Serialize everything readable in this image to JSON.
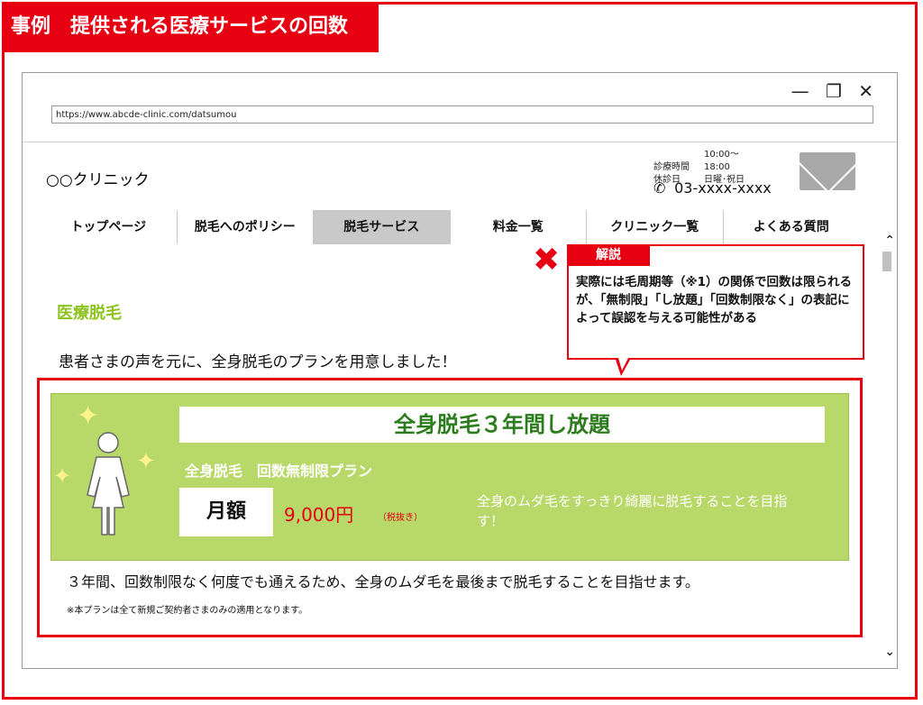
{
  "header": {
    "title": "事例　提供される医療サービスの回数"
  },
  "browser": {
    "url": "https://www.abcde-clinic.com/datsumou",
    "controls": [
      "—",
      "❐",
      "✕"
    ]
  },
  "clinic": {
    "name": "○○クリニック",
    "hours_label": "診療時間",
    "hours_value": "10:00～18:00",
    "closed_label": "休診日",
    "closed_value": "日曜･祝日",
    "phone": "03-xxxx-xxxx"
  },
  "nav": {
    "items": [
      "トップページ",
      "脱毛へのポリシー",
      "脱毛サービス",
      "料金一覧",
      "クリニック一覧",
      "よくある質問"
    ]
  },
  "callout": {
    "label": "解説",
    "text": "実際には毛周期等（※1）の関係で回数は限られるが、「無制限」「し放題」「回数制限なく」の表記によって誤認を与える可能性がある"
  },
  "content": {
    "heading": "医療脱毛",
    "intro": "患者さまの声を元に、全身脱毛のプランを用意しました！"
  },
  "plan": {
    "title": "全身脱毛３年間し放題",
    "subtitle": "全身脱毛　回数無制限プラン",
    "monthly_label": "月額",
    "price": "9,000円",
    "tax": "（税抜き）",
    "description": "全身のムダ毛をすっきり綺麗に脱毛することを目指す！",
    "note_main": "３年間、回数制限なく何度でも通えるため、全身のムダ毛を最後まで脱毛することを目指せます。",
    "note_small": "※本プランは全て新規ご契約者さまのみの適用となります。"
  },
  "colors": {
    "accent_red": "#e60012",
    "green_panel": "#b8d96a",
    "title_green": "#2b7c1c"
  }
}
